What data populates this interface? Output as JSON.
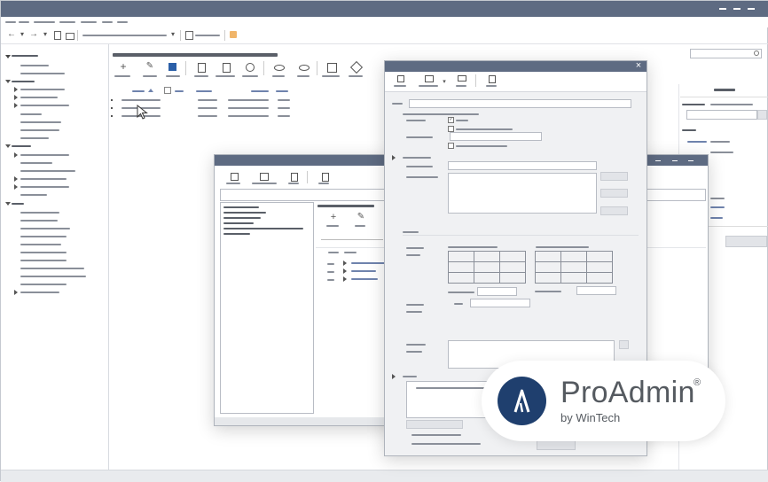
{
  "app": {
    "accent": "#5e6b82",
    "link_color": "#6f83ad"
  },
  "dialog": {
    "close_label": "×"
  },
  "brand": {
    "name": "ProAdmin",
    "registered": "®",
    "tagline": "by WinTech",
    "logo_color": "#1f3f6e"
  },
  "icons": {
    "back": "←",
    "forward": "→",
    "dropdown": "▾",
    "add": "+",
    "edit": "✎",
    "close": "×",
    "minimize": "—",
    "search": "⌕"
  }
}
